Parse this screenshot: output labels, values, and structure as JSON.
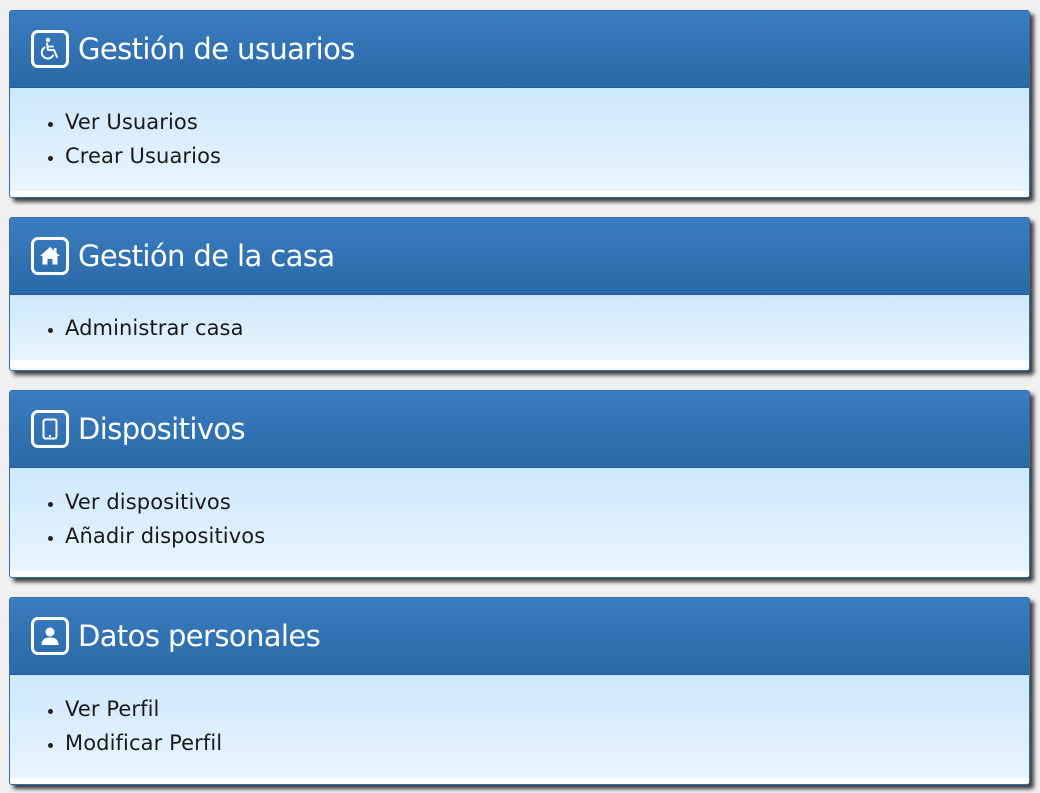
{
  "colors": {
    "header_blue": "#2f72b4",
    "body_light_blue": "#d6ecfc",
    "page_background": "#f0f0f0"
  },
  "panels": [
    {
      "title": "Gestión de usuarios",
      "icon": "wheelchair-icon",
      "items": [
        "Ver Usuarios",
        "Crear Usuarios"
      ]
    },
    {
      "title": "Gestión de la casa",
      "icon": "home-icon",
      "items": [
        "Administrar casa"
      ]
    },
    {
      "title": "Dispositivos",
      "icon": "tablet-icon",
      "items": [
        "Ver dispositivos",
        "Añadir dispositivos"
      ]
    },
    {
      "title": "Datos personales",
      "icon": "user-icon",
      "items": [
        "Ver Perfil",
        "Modificar Perfil"
      ]
    }
  ]
}
